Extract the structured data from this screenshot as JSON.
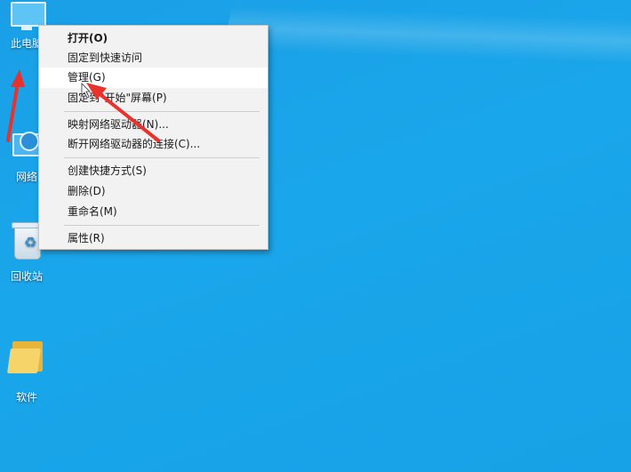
{
  "desktop": {
    "icons": [
      {
        "label": "此电脑",
        "icon": "this-pc-icon"
      },
      {
        "label": "网络",
        "icon": "network-icon"
      },
      {
        "label": "回收站",
        "icon": "recycle-bin-icon"
      },
      {
        "label": "软件",
        "icon": "folder-icon"
      }
    ]
  },
  "context_menu": {
    "items": [
      {
        "label": "打开(O)"
      },
      {
        "label": "固定到快速访问"
      },
      {
        "label": "管理(G)"
      },
      {
        "label": "固定到\"开始\"屏幕(P)"
      },
      {
        "label": "映射网络驱动器(N)..."
      },
      {
        "label": "断开网络驱动器的连接(C)..."
      },
      {
        "label": "创建快捷方式(S)"
      },
      {
        "label": "删除(D)"
      },
      {
        "label": "重命名(M)"
      },
      {
        "label": "属性(R)"
      }
    ]
  },
  "colors": {
    "desktop_bg": "#1aa6ea",
    "annotation_arrow": "#e8322b",
    "menu_bg": "#f2f2f2"
  }
}
